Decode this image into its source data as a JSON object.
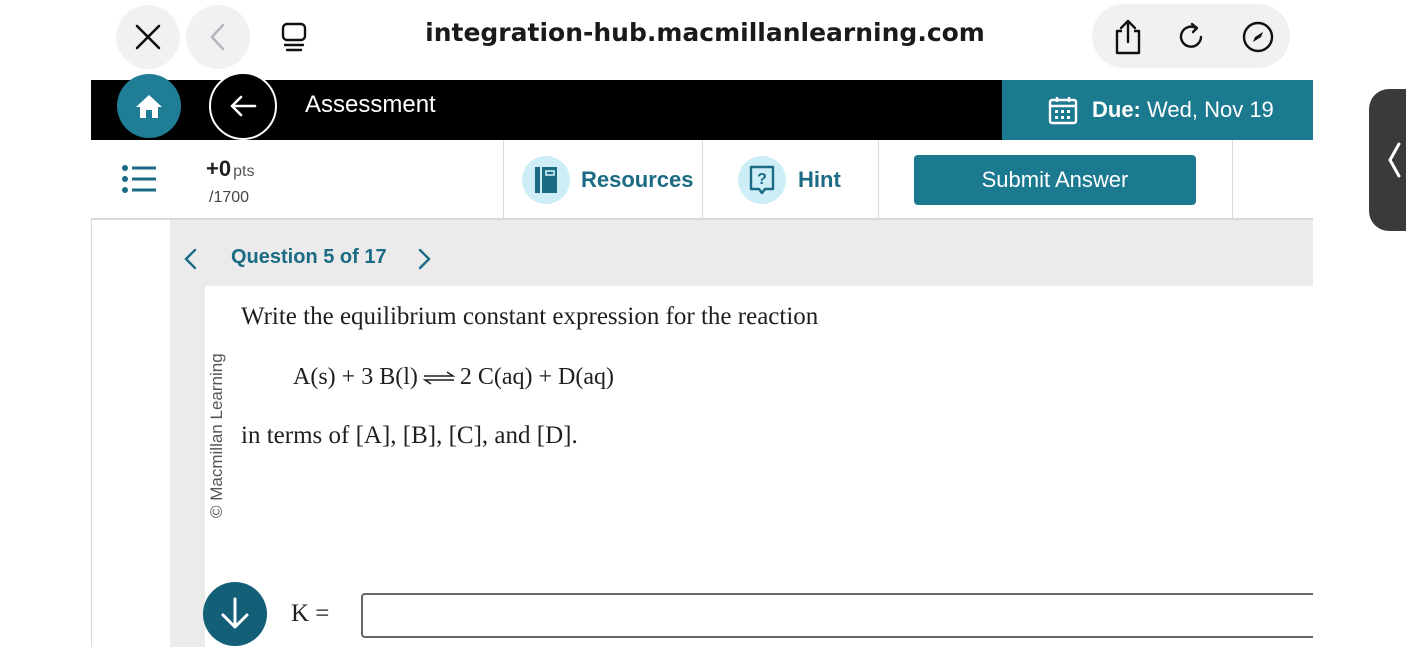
{
  "browser": {
    "url": "integration-hub.macmillanlearning.com",
    "icons": [
      "close-icon",
      "back-icon",
      "tabs-icon",
      "share-icon",
      "reload-icon",
      "compass-icon"
    ]
  },
  "header": {
    "title": "Assessment",
    "due_label": "Due:",
    "due_value": "Wed, Nov 19",
    "colors": {
      "bar": "#000000",
      "accent": "#1b7990"
    }
  },
  "toolbar": {
    "points": "+0",
    "points_unit": "pts",
    "total": "/1700",
    "resources_label": "Resources",
    "hint_label": "Hint",
    "submit_label": "Submit Answer"
  },
  "question_nav": {
    "label": "Question 5 of 17"
  },
  "question": {
    "copyright": "© Macmillan Learning",
    "prompt": "Write the equilibrium constant expression for the reaction",
    "reaction_left": "A(s) + 3 B(l)",
    "reaction_right": "2 C(aq) + D(aq)",
    "terms": "in terms of [A], [B], [C], and [D].",
    "answer_label": "K =",
    "answer_value": ""
  }
}
